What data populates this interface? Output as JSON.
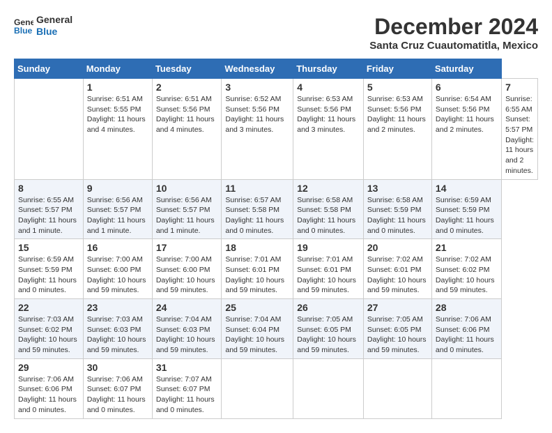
{
  "header": {
    "logo_line1": "General",
    "logo_line2": "Blue",
    "main_title": "December 2024",
    "subtitle": "Santa Cruz Cuautomatitla, Mexico"
  },
  "calendar": {
    "days_of_week": [
      "Sunday",
      "Monday",
      "Tuesday",
      "Wednesday",
      "Thursday",
      "Friday",
      "Saturday"
    ],
    "weeks": [
      [
        {
          "day": "",
          "info": ""
        },
        {
          "day": "1",
          "info": "Sunrise: 6:51 AM\nSunset: 5:55 PM\nDaylight: 11 hours and 4 minutes."
        },
        {
          "day": "2",
          "info": "Sunrise: 6:51 AM\nSunset: 5:56 PM\nDaylight: 11 hours and 4 minutes."
        },
        {
          "day": "3",
          "info": "Sunrise: 6:52 AM\nSunset: 5:56 PM\nDaylight: 11 hours and 3 minutes."
        },
        {
          "day": "4",
          "info": "Sunrise: 6:53 AM\nSunset: 5:56 PM\nDaylight: 11 hours and 3 minutes."
        },
        {
          "day": "5",
          "info": "Sunrise: 6:53 AM\nSunset: 5:56 PM\nDaylight: 11 hours and 2 minutes."
        },
        {
          "day": "6",
          "info": "Sunrise: 6:54 AM\nSunset: 5:56 PM\nDaylight: 11 hours and 2 minutes."
        },
        {
          "day": "7",
          "info": "Sunrise: 6:55 AM\nSunset: 5:57 PM\nDaylight: 11 hours and 2 minutes."
        }
      ],
      [
        {
          "day": "8",
          "info": "Sunrise: 6:55 AM\nSunset: 5:57 PM\nDaylight: 11 hours and 1 minute."
        },
        {
          "day": "9",
          "info": "Sunrise: 6:56 AM\nSunset: 5:57 PM\nDaylight: 11 hours and 1 minute."
        },
        {
          "day": "10",
          "info": "Sunrise: 6:56 AM\nSunset: 5:57 PM\nDaylight: 11 hours and 1 minute."
        },
        {
          "day": "11",
          "info": "Sunrise: 6:57 AM\nSunset: 5:58 PM\nDaylight: 11 hours and 0 minutes."
        },
        {
          "day": "12",
          "info": "Sunrise: 6:58 AM\nSunset: 5:58 PM\nDaylight: 11 hours and 0 minutes."
        },
        {
          "day": "13",
          "info": "Sunrise: 6:58 AM\nSunset: 5:59 PM\nDaylight: 11 hours and 0 minutes."
        },
        {
          "day": "14",
          "info": "Sunrise: 6:59 AM\nSunset: 5:59 PM\nDaylight: 11 hours and 0 minutes."
        }
      ],
      [
        {
          "day": "15",
          "info": "Sunrise: 6:59 AM\nSunset: 5:59 PM\nDaylight: 11 hours and 0 minutes."
        },
        {
          "day": "16",
          "info": "Sunrise: 7:00 AM\nSunset: 6:00 PM\nDaylight: 10 hours and 59 minutes."
        },
        {
          "day": "17",
          "info": "Sunrise: 7:00 AM\nSunset: 6:00 PM\nDaylight: 10 hours and 59 minutes."
        },
        {
          "day": "18",
          "info": "Sunrise: 7:01 AM\nSunset: 6:01 PM\nDaylight: 10 hours and 59 minutes."
        },
        {
          "day": "19",
          "info": "Sunrise: 7:01 AM\nSunset: 6:01 PM\nDaylight: 10 hours and 59 minutes."
        },
        {
          "day": "20",
          "info": "Sunrise: 7:02 AM\nSunset: 6:01 PM\nDaylight: 10 hours and 59 minutes."
        },
        {
          "day": "21",
          "info": "Sunrise: 7:02 AM\nSunset: 6:02 PM\nDaylight: 10 hours and 59 minutes."
        }
      ],
      [
        {
          "day": "22",
          "info": "Sunrise: 7:03 AM\nSunset: 6:02 PM\nDaylight: 10 hours and 59 minutes."
        },
        {
          "day": "23",
          "info": "Sunrise: 7:03 AM\nSunset: 6:03 PM\nDaylight: 10 hours and 59 minutes."
        },
        {
          "day": "24",
          "info": "Sunrise: 7:04 AM\nSunset: 6:03 PM\nDaylight: 10 hours and 59 minutes."
        },
        {
          "day": "25",
          "info": "Sunrise: 7:04 AM\nSunset: 6:04 PM\nDaylight: 10 hours and 59 minutes."
        },
        {
          "day": "26",
          "info": "Sunrise: 7:05 AM\nSunset: 6:05 PM\nDaylight: 10 hours and 59 minutes."
        },
        {
          "day": "27",
          "info": "Sunrise: 7:05 AM\nSunset: 6:05 PM\nDaylight: 10 hours and 59 minutes."
        },
        {
          "day": "28",
          "info": "Sunrise: 7:06 AM\nSunset: 6:06 PM\nDaylight: 11 hours and 0 minutes."
        }
      ],
      [
        {
          "day": "29",
          "info": "Sunrise: 7:06 AM\nSunset: 6:06 PM\nDaylight: 11 hours and 0 minutes."
        },
        {
          "day": "30",
          "info": "Sunrise: 7:06 AM\nSunset: 6:07 PM\nDaylight: 11 hours and 0 minutes."
        },
        {
          "day": "31",
          "info": "Sunrise: 7:07 AM\nSunset: 6:07 PM\nDaylight: 11 hours and 0 minutes."
        },
        {
          "day": "",
          "info": ""
        },
        {
          "day": "",
          "info": ""
        },
        {
          "day": "",
          "info": ""
        },
        {
          "day": "",
          "info": ""
        }
      ]
    ]
  }
}
